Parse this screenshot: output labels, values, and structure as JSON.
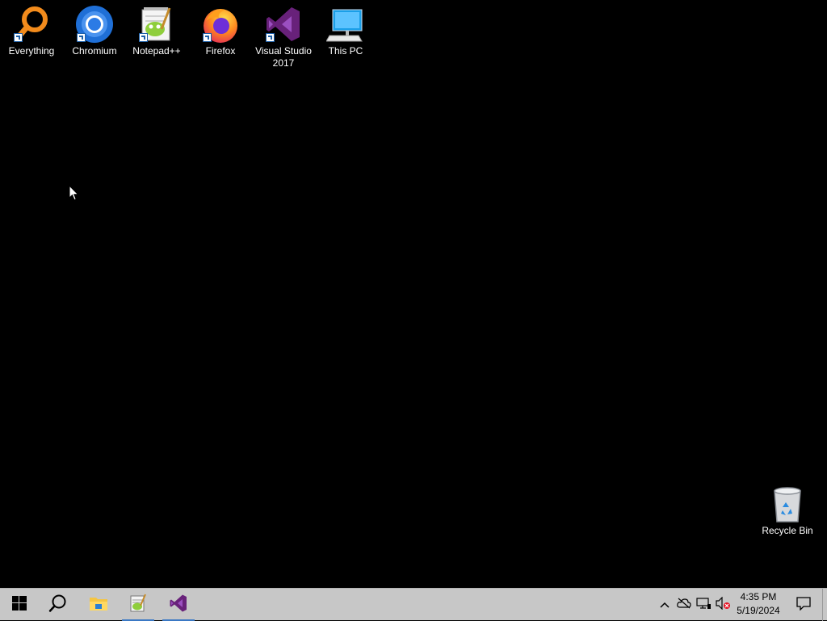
{
  "desktop": {
    "icons": [
      {
        "label": "Everything",
        "icon": "everything-search-icon"
      },
      {
        "label": "Chromium",
        "icon": "chromium-icon"
      },
      {
        "label": "Notepad++",
        "icon": "notepad-plus-plus-icon"
      },
      {
        "label": "Firefox",
        "icon": "firefox-icon"
      },
      {
        "label": "Visual Studio 2017",
        "icon": "visual-studio-icon"
      },
      {
        "label": "This PC",
        "icon": "computer-icon"
      },
      {
        "label": "Recycle Bin",
        "icon": "recycle-bin-icon"
      }
    ]
  },
  "taskbar": {
    "pinned": [
      {
        "icon": "windows-start-icon"
      },
      {
        "icon": "search-icon"
      },
      {
        "icon": "file-explorer-icon"
      },
      {
        "icon": "notepad-plus-plus-icon"
      },
      {
        "icon": "visual-studio-icon"
      }
    ],
    "tray": {
      "icons": [
        "chevron-up-icon",
        "onedrive-offline-icon",
        "network-icon",
        "volume-muted-icon"
      ],
      "time": "4:35 PM",
      "date": "5/19/2024"
    }
  },
  "colors": {
    "taskbar_bg": "#c7c7c7",
    "desktop_bg": "#000000",
    "vs_purple": "#68217a",
    "active_indicator": "#3a78c4"
  }
}
